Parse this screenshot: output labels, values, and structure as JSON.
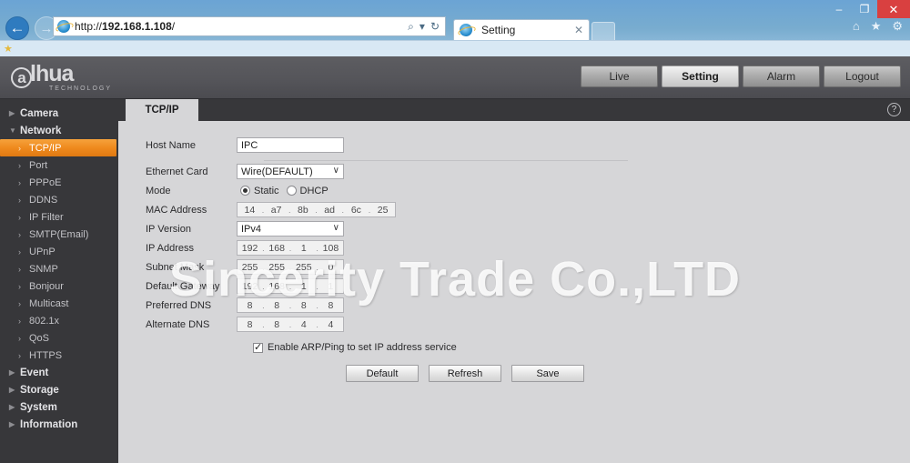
{
  "browser": {
    "window_controls": {
      "minimize": "–",
      "maximize": "❐",
      "close": "✕"
    },
    "back_icon": "←",
    "forward_icon": "→",
    "url": "http://192.168.1.108/",
    "url_scheme": "http://",
    "url_host": "192.168.1.108",
    "url_path": "/",
    "search_icon": "⌕",
    "dropdown_icon": "▾",
    "refresh_icon": "↻",
    "tab_title": "Setting",
    "tab_close": "✕",
    "home_icon": "⌂",
    "favorites_icon": "★",
    "tools_icon": "⚙",
    "bookmark_icon": "★"
  },
  "header": {
    "logo_a": "a",
    "logo_text": "lhua",
    "logo_sub": "TECHNOLOGY",
    "nav": [
      {
        "label": "Live",
        "active": false
      },
      {
        "label": "Setting",
        "active": true
      },
      {
        "label": "Alarm",
        "active": false
      },
      {
        "label": "Logout",
        "active": false
      }
    ]
  },
  "sidebar": {
    "items": [
      {
        "label": "Camera",
        "level": "top",
        "arrow": "▶",
        "active": false
      },
      {
        "label": "Network",
        "level": "top",
        "arrow": "▼",
        "active": false
      },
      {
        "label": "TCP/IP",
        "level": "sub",
        "arrow": "›",
        "active": true
      },
      {
        "label": "Port",
        "level": "sub",
        "arrow": "›",
        "active": false
      },
      {
        "label": "PPPoE",
        "level": "sub",
        "arrow": "›",
        "active": false
      },
      {
        "label": "DDNS",
        "level": "sub",
        "arrow": "›",
        "active": false
      },
      {
        "label": "IP Filter",
        "level": "sub",
        "arrow": "›",
        "active": false
      },
      {
        "label": "SMTP(Email)",
        "level": "sub",
        "arrow": "›",
        "active": false
      },
      {
        "label": "UPnP",
        "level": "sub",
        "arrow": "›",
        "active": false
      },
      {
        "label": "SNMP",
        "level": "sub",
        "arrow": "›",
        "active": false
      },
      {
        "label": "Bonjour",
        "level": "sub",
        "arrow": "›",
        "active": false
      },
      {
        "label": "Multicast",
        "level": "sub",
        "arrow": "›",
        "active": false
      },
      {
        "label": "802.1x",
        "level": "sub",
        "arrow": "›",
        "active": false
      },
      {
        "label": "QoS",
        "level": "sub",
        "arrow": "›",
        "active": false
      },
      {
        "label": "HTTPS",
        "level": "sub",
        "arrow": "›",
        "active": false
      },
      {
        "label": "Event",
        "level": "top",
        "arrow": "▶",
        "active": false
      },
      {
        "label": "Storage",
        "level": "top",
        "arrow": "▶",
        "active": false
      },
      {
        "label": "System",
        "level": "top",
        "arrow": "▶",
        "active": false
      },
      {
        "label": "Information",
        "level": "top",
        "arrow": "▶",
        "active": false
      }
    ]
  },
  "content": {
    "tab_label": "TCP/IP",
    "help_icon": "?",
    "fields": {
      "host_name": {
        "label": "Host Name",
        "value": "IPC"
      },
      "ethernet_card": {
        "label": "Ethernet Card",
        "value": "Wire(DEFAULT)",
        "chevron": "∨"
      },
      "mode": {
        "label": "Mode",
        "selected": "Static",
        "options": [
          "Static",
          "DHCP"
        ]
      },
      "mac_address": {
        "label": "MAC Address",
        "octets": [
          "14",
          "a7",
          "8b",
          "ad",
          "6c",
          "25"
        ]
      },
      "ip_version": {
        "label": "IP Version",
        "value": "IPv4",
        "chevron": "∨"
      },
      "ip_address": {
        "label": "IP Address",
        "octets": [
          "192",
          "168",
          "1",
          "108"
        ]
      },
      "subnet_mask": {
        "label": "Subnet Mask",
        "octets": [
          "255",
          "255",
          "255",
          "0"
        ]
      },
      "default_gateway": {
        "label": "Default Gateway",
        "octets": [
          "192",
          "168",
          "1",
          "1"
        ]
      },
      "preferred_dns": {
        "label": "Preferred DNS",
        "octets": [
          "8",
          "8",
          "8",
          "8"
        ]
      },
      "alternate_dns": {
        "label": "Alternate DNS",
        "octets": [
          "8",
          "8",
          "4",
          "4"
        ]
      }
    },
    "arp_ping": {
      "label": "Enable ARP/Ping to set IP address service",
      "checked": true
    },
    "buttons": [
      {
        "label": "Default"
      },
      {
        "label": "Refresh"
      },
      {
        "label": "Save"
      }
    ]
  },
  "watermark": {
    "text": "Sincerity Trade Co.,LTD"
  }
}
